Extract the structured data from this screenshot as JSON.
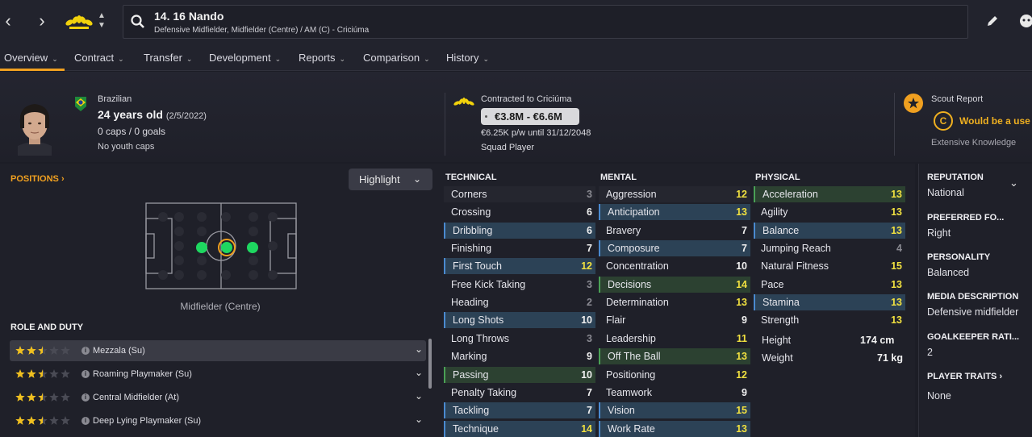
{
  "header": {
    "title": "14. 16 Nando",
    "subtitle": "Defensive Midfielder, Midfielder (Centre) / AM (C) - Criciúma"
  },
  "tabs": [
    {
      "label": "Overview"
    },
    {
      "label": "Contract"
    },
    {
      "label": "Transfer"
    },
    {
      "label": "Development"
    },
    {
      "label": "Reports"
    },
    {
      "label": "Comparison"
    },
    {
      "label": "History"
    }
  ],
  "player": {
    "nationality": "Brazilian",
    "age": "24 years old",
    "dob": "(2/5/2022)",
    "caps": "0 caps / 0 goals",
    "youth_caps": "No youth caps"
  },
  "contract": {
    "club": "Contracted to Criciúma",
    "value": "€3.8M - €6.6M",
    "wage": "€6.25K p/w until 31/12/2048",
    "status": "Squad Player"
  },
  "scout": {
    "title": "Scout Report",
    "summary": "Would be a use",
    "grade": "C",
    "knowledge": "Extensive Knowledge"
  },
  "positions": {
    "title": "POSITIONS ›",
    "highlight_label": "Highlight",
    "pitch_label": "Midfielder (Centre)"
  },
  "roles": {
    "title": "ROLE AND DUTY",
    "items": [
      {
        "label": "Mezzala (Su)",
        "stars": 2.5
      },
      {
        "label": "Roaming Playmaker (Su)",
        "stars": 2.5
      },
      {
        "label": "Central Midfielder (At)",
        "stars": 2.5
      },
      {
        "label": "Deep Lying Playmaker (Su)",
        "stars": 2.5
      }
    ]
  },
  "attributes": {
    "technical_title": "TECHNICAL",
    "mental_title": "MENTAL",
    "physical_title": "PHYSICAL",
    "technical": [
      {
        "name": "Corners",
        "value": "3",
        "hl": "plain"
      },
      {
        "name": "Crossing",
        "value": "6",
        "hl": "none"
      },
      {
        "name": "Dribbling",
        "value": "6",
        "hl": "blue"
      },
      {
        "name": "Finishing",
        "value": "7",
        "hl": "none"
      },
      {
        "name": "First Touch",
        "value": "12",
        "hl": "blue"
      },
      {
        "name": "Free Kick Taking",
        "value": "3",
        "hl": "none"
      },
      {
        "name": "Heading",
        "value": "2",
        "hl": "none"
      },
      {
        "name": "Long Shots",
        "value": "10",
        "hl": "blue"
      },
      {
        "name": "Long Throws",
        "value": "3",
        "hl": "none"
      },
      {
        "name": "Marking",
        "value": "9",
        "hl": "none"
      },
      {
        "name": "Passing",
        "value": "10",
        "hl": "green"
      },
      {
        "name": "Penalty Taking",
        "value": "7",
        "hl": "none"
      },
      {
        "name": "Tackling",
        "value": "7",
        "hl": "blue"
      },
      {
        "name": "Technique",
        "value": "14",
        "hl": "blue"
      }
    ],
    "mental": [
      {
        "name": "Aggression",
        "value": "12",
        "hl": "plain"
      },
      {
        "name": "Anticipation",
        "value": "13",
        "hl": "blue"
      },
      {
        "name": "Bravery",
        "value": "7",
        "hl": "none"
      },
      {
        "name": "Composure",
        "value": "7",
        "hl": "blue"
      },
      {
        "name": "Concentration",
        "value": "10",
        "hl": "none"
      },
      {
        "name": "Decisions",
        "value": "14",
        "hl": "green"
      },
      {
        "name": "Determination",
        "value": "13",
        "hl": "none"
      },
      {
        "name": "Flair",
        "value": "9",
        "hl": "none"
      },
      {
        "name": "Leadership",
        "value": "11",
        "hl": "none"
      },
      {
        "name": "Off The Ball",
        "value": "13",
        "hl": "green"
      },
      {
        "name": "Positioning",
        "value": "12",
        "hl": "none"
      },
      {
        "name": "Teamwork",
        "value": "9",
        "hl": "none"
      },
      {
        "name": "Vision",
        "value": "15",
        "hl": "blue"
      },
      {
        "name": "Work Rate",
        "value": "13",
        "hl": "blue"
      }
    ],
    "physical": [
      {
        "name": "Acceleration",
        "value": "13",
        "hl": "green"
      },
      {
        "name": "Agility",
        "value": "13",
        "hl": "none"
      },
      {
        "name": "Balance",
        "value": "13",
        "hl": "blue"
      },
      {
        "name": "Jumping Reach",
        "value": "4",
        "hl": "none"
      },
      {
        "name": "Natural Fitness",
        "value": "15",
        "hl": "none"
      },
      {
        "name": "Pace",
        "value": "13",
        "hl": "none"
      },
      {
        "name": "Stamina",
        "value": "13",
        "hl": "blue"
      },
      {
        "name": "Strength",
        "value": "13",
        "hl": "none"
      }
    ],
    "height_label": "Height",
    "height_value": "174 cm",
    "weight_label": "Weight",
    "weight_value": "71 kg"
  },
  "side_info": {
    "reputation_label": "REPUTATION",
    "reputation_value": "National",
    "foot_label": "PREFERRED FO...",
    "foot_value": "Right",
    "personality_label": "PERSONALITY",
    "personality_value": "Balanced",
    "media_label": "MEDIA DESCRIPTION",
    "media_value": "Defensive midfielder",
    "gk_label": "GOALKEEPER RATI...",
    "gk_value": "2",
    "traits_label": "PLAYER TRAITS ›",
    "traits_value": "None"
  },
  "colors": {
    "accent": "#f0a020",
    "high_value": "#f0e040",
    "blue_highlight": "#2c4256",
    "green_highlight": "#2c4131"
  }
}
